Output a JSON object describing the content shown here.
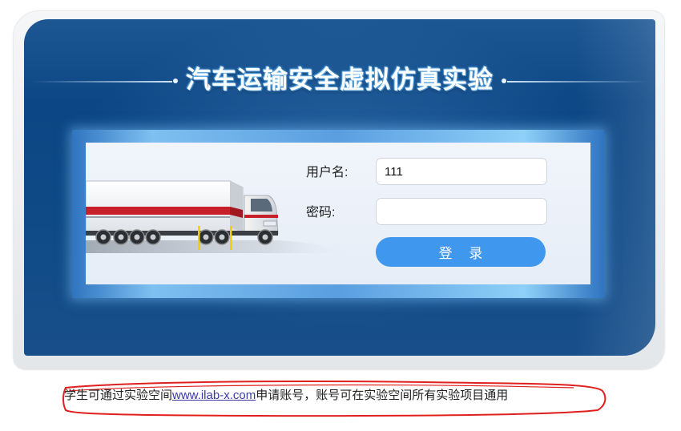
{
  "title": "汽车运输安全虚拟仿真实验",
  "login": {
    "username_label": "用户名:",
    "username_value": "111",
    "password_label": "密码:",
    "password_value": "",
    "submit_label": "登 录"
  },
  "note": {
    "prefix": "学生可通过实验空间",
    "link_text": "www.ilab-x.com",
    "suffix": "申请账号，账号可在实验空间所有实验项目通用"
  },
  "colors": {
    "panel_blue": "#0c4684",
    "button_blue": "#3f98ee",
    "annotation_red": "#e0201e"
  }
}
